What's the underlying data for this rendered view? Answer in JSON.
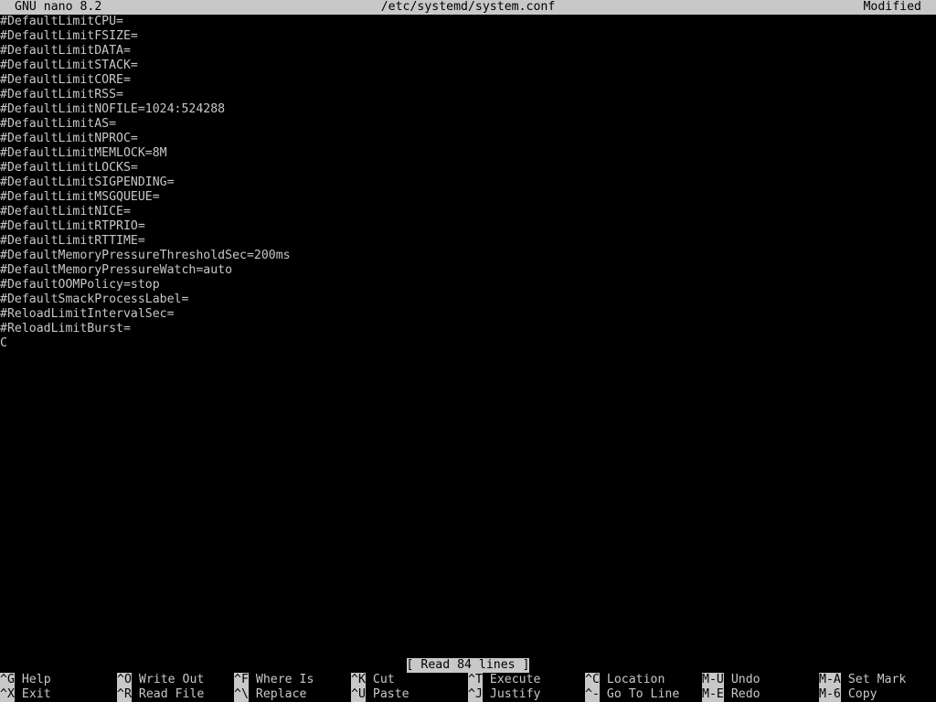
{
  "title": {
    "app": "GNU nano 8.2",
    "file": "/etc/systemd/system.conf",
    "status": "Modified"
  },
  "lines": [
    "#DefaultLimitCPU=",
    "#DefaultLimitFSIZE=",
    "#DefaultLimitDATA=",
    "#DefaultLimitSTACK=",
    "#DefaultLimitCORE=",
    "#DefaultLimitRSS=",
    "#DefaultLimitNOFILE=1024:524288",
    "#DefaultLimitAS=",
    "#DefaultLimitNPROC=",
    "#DefaultLimitMEMLOCK=8M",
    "#DefaultLimitLOCKS=",
    "#DefaultLimitSIGPENDING=",
    "#DefaultLimitMSGQUEUE=",
    "#DefaultLimitNICE=",
    "#DefaultLimitRTPRIO=",
    "#DefaultLimitRTTIME=",
    "#DefaultMemoryPressureThresholdSec=200ms",
    "#DefaultMemoryPressureWatch=auto",
    "#DefaultOOMPolicy=stop",
    "#DefaultSmackProcessLabel=",
    "#ReloadLimitIntervalSec=",
    "#ReloadLimitBurst=",
    "C"
  ],
  "status_message": "[ Read 84 lines ]",
  "shortcuts_row1": [
    {
      "key": "^G",
      "label": "Help"
    },
    {
      "key": "^O",
      "label": "Write Out"
    },
    {
      "key": "^F",
      "label": "Where Is"
    },
    {
      "key": "^K",
      "label": "Cut"
    },
    {
      "key": "^T",
      "label": "Execute"
    },
    {
      "key": "^C",
      "label": "Location"
    },
    {
      "key": "M-U",
      "label": "Undo"
    },
    {
      "key": "M-A",
      "label": "Set Mark"
    }
  ],
  "shortcuts_row2": [
    {
      "key": "^X",
      "label": "Exit"
    },
    {
      "key": "^R",
      "label": "Read File"
    },
    {
      "key": "^\\",
      "label": "Replace"
    },
    {
      "key": "^U",
      "label": "Paste"
    },
    {
      "key": "^J",
      "label": "Justify"
    },
    {
      "key": "^-",
      "label": "Go To Line"
    },
    {
      "key": "M-E",
      "label": "Redo"
    },
    {
      "key": "M-6",
      "label": "Copy"
    }
  ]
}
